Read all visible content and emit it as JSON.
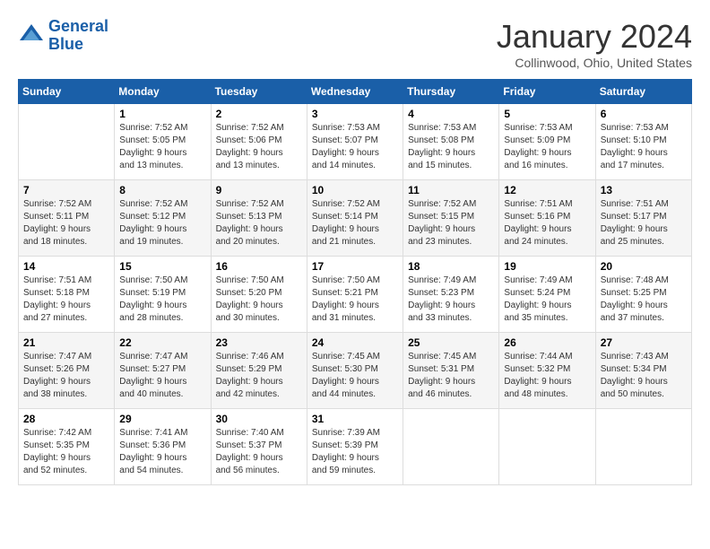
{
  "header": {
    "logo_line1": "General",
    "logo_line2": "Blue",
    "title": "January 2024",
    "subtitle": "Collinwood, Ohio, United States"
  },
  "weekdays": [
    "Sunday",
    "Monday",
    "Tuesday",
    "Wednesday",
    "Thursday",
    "Friday",
    "Saturday"
  ],
  "weeks": [
    [
      {
        "day": "",
        "info": ""
      },
      {
        "day": "1",
        "info": "Sunrise: 7:52 AM\nSunset: 5:05 PM\nDaylight: 9 hours\nand 13 minutes."
      },
      {
        "day": "2",
        "info": "Sunrise: 7:52 AM\nSunset: 5:06 PM\nDaylight: 9 hours\nand 13 minutes."
      },
      {
        "day": "3",
        "info": "Sunrise: 7:53 AM\nSunset: 5:07 PM\nDaylight: 9 hours\nand 14 minutes."
      },
      {
        "day": "4",
        "info": "Sunrise: 7:53 AM\nSunset: 5:08 PM\nDaylight: 9 hours\nand 15 minutes."
      },
      {
        "day": "5",
        "info": "Sunrise: 7:53 AM\nSunset: 5:09 PM\nDaylight: 9 hours\nand 16 minutes."
      },
      {
        "day": "6",
        "info": "Sunrise: 7:53 AM\nSunset: 5:10 PM\nDaylight: 9 hours\nand 17 minutes."
      }
    ],
    [
      {
        "day": "7",
        "info": "Sunrise: 7:52 AM\nSunset: 5:11 PM\nDaylight: 9 hours\nand 18 minutes."
      },
      {
        "day": "8",
        "info": "Sunrise: 7:52 AM\nSunset: 5:12 PM\nDaylight: 9 hours\nand 19 minutes."
      },
      {
        "day": "9",
        "info": "Sunrise: 7:52 AM\nSunset: 5:13 PM\nDaylight: 9 hours\nand 20 minutes."
      },
      {
        "day": "10",
        "info": "Sunrise: 7:52 AM\nSunset: 5:14 PM\nDaylight: 9 hours\nand 21 minutes."
      },
      {
        "day": "11",
        "info": "Sunrise: 7:52 AM\nSunset: 5:15 PM\nDaylight: 9 hours\nand 23 minutes."
      },
      {
        "day": "12",
        "info": "Sunrise: 7:51 AM\nSunset: 5:16 PM\nDaylight: 9 hours\nand 24 minutes."
      },
      {
        "day": "13",
        "info": "Sunrise: 7:51 AM\nSunset: 5:17 PM\nDaylight: 9 hours\nand 25 minutes."
      }
    ],
    [
      {
        "day": "14",
        "info": "Sunrise: 7:51 AM\nSunset: 5:18 PM\nDaylight: 9 hours\nand 27 minutes."
      },
      {
        "day": "15",
        "info": "Sunrise: 7:50 AM\nSunset: 5:19 PM\nDaylight: 9 hours\nand 28 minutes."
      },
      {
        "day": "16",
        "info": "Sunrise: 7:50 AM\nSunset: 5:20 PM\nDaylight: 9 hours\nand 30 minutes."
      },
      {
        "day": "17",
        "info": "Sunrise: 7:50 AM\nSunset: 5:21 PM\nDaylight: 9 hours\nand 31 minutes."
      },
      {
        "day": "18",
        "info": "Sunrise: 7:49 AM\nSunset: 5:23 PM\nDaylight: 9 hours\nand 33 minutes."
      },
      {
        "day": "19",
        "info": "Sunrise: 7:49 AM\nSunset: 5:24 PM\nDaylight: 9 hours\nand 35 minutes."
      },
      {
        "day": "20",
        "info": "Sunrise: 7:48 AM\nSunset: 5:25 PM\nDaylight: 9 hours\nand 37 minutes."
      }
    ],
    [
      {
        "day": "21",
        "info": "Sunrise: 7:47 AM\nSunset: 5:26 PM\nDaylight: 9 hours\nand 38 minutes."
      },
      {
        "day": "22",
        "info": "Sunrise: 7:47 AM\nSunset: 5:27 PM\nDaylight: 9 hours\nand 40 minutes."
      },
      {
        "day": "23",
        "info": "Sunrise: 7:46 AM\nSunset: 5:29 PM\nDaylight: 9 hours\nand 42 minutes."
      },
      {
        "day": "24",
        "info": "Sunrise: 7:45 AM\nSunset: 5:30 PM\nDaylight: 9 hours\nand 44 minutes."
      },
      {
        "day": "25",
        "info": "Sunrise: 7:45 AM\nSunset: 5:31 PM\nDaylight: 9 hours\nand 46 minutes."
      },
      {
        "day": "26",
        "info": "Sunrise: 7:44 AM\nSunset: 5:32 PM\nDaylight: 9 hours\nand 48 minutes."
      },
      {
        "day": "27",
        "info": "Sunrise: 7:43 AM\nSunset: 5:34 PM\nDaylight: 9 hours\nand 50 minutes."
      }
    ],
    [
      {
        "day": "28",
        "info": "Sunrise: 7:42 AM\nSunset: 5:35 PM\nDaylight: 9 hours\nand 52 minutes."
      },
      {
        "day": "29",
        "info": "Sunrise: 7:41 AM\nSunset: 5:36 PM\nDaylight: 9 hours\nand 54 minutes."
      },
      {
        "day": "30",
        "info": "Sunrise: 7:40 AM\nSunset: 5:37 PM\nDaylight: 9 hours\nand 56 minutes."
      },
      {
        "day": "31",
        "info": "Sunrise: 7:39 AM\nSunset: 5:39 PM\nDaylight: 9 hours\nand 59 minutes."
      },
      {
        "day": "",
        "info": ""
      },
      {
        "day": "",
        "info": ""
      },
      {
        "day": "",
        "info": ""
      }
    ]
  ]
}
